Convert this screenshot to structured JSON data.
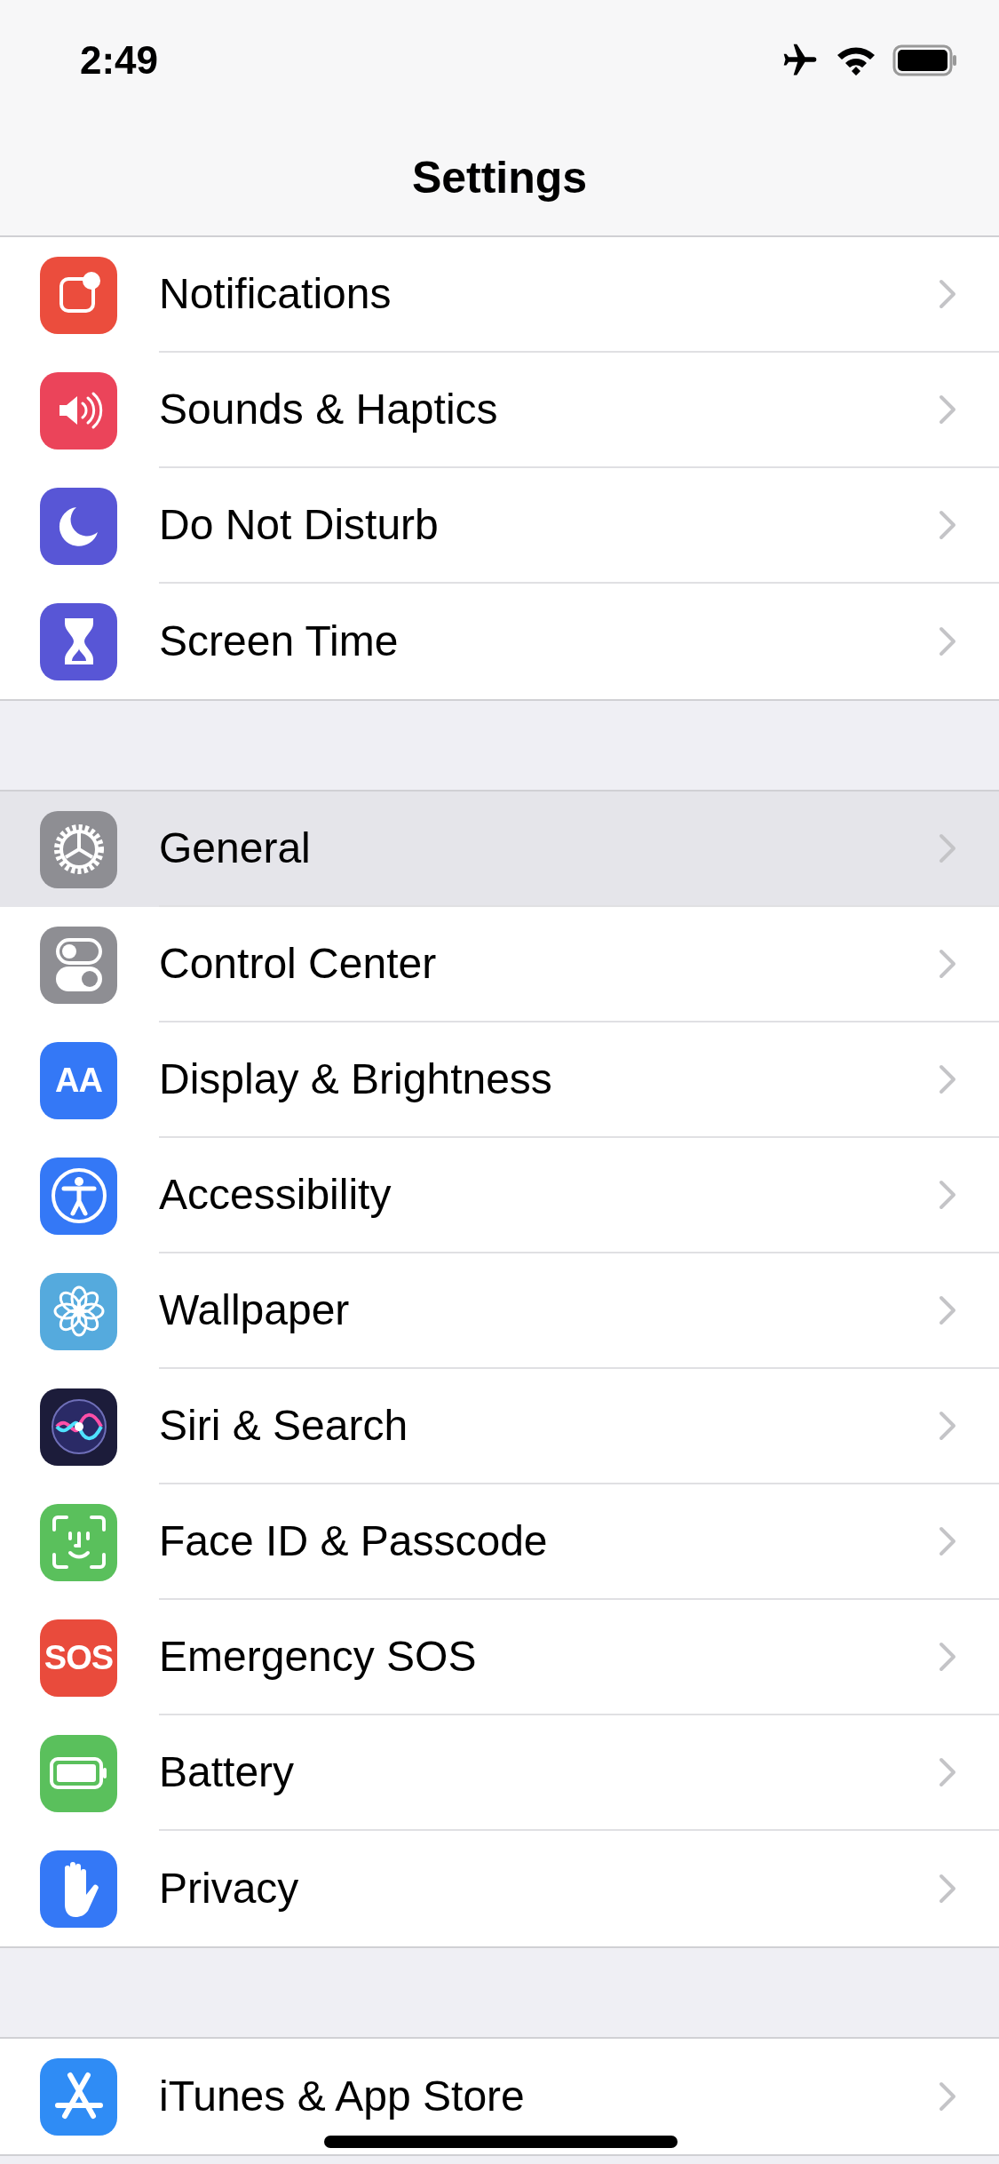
{
  "status_bar": {
    "time": "2:49"
  },
  "nav": {
    "title": "Settings"
  },
  "groups": [
    {
      "items": [
        {
          "label": "Notifications",
          "kind": "notifications",
          "color": "#eb4d3d",
          "selected": false
        },
        {
          "label": "Sounds & Haptics",
          "kind": "sound",
          "color": "#eb445a",
          "selected": false
        },
        {
          "label": "Do Not Disturb",
          "kind": "moon",
          "color": "#5856d6",
          "selected": false
        },
        {
          "label": "Screen Time",
          "kind": "hourglass",
          "color": "#5856d6",
          "selected": false
        }
      ]
    },
    {
      "items": [
        {
          "label": "General",
          "kind": "gear",
          "color": "#8e8e93",
          "selected": true
        },
        {
          "label": "Control Center",
          "kind": "toggles",
          "color": "#8e8e93",
          "selected": false
        },
        {
          "label": "Display & Brightness",
          "kind": "text",
          "icon_text": "AA",
          "color": "#3478f6",
          "selected": false
        },
        {
          "label": "Accessibility",
          "kind": "accessibility",
          "color": "#3478f6",
          "selected": false
        },
        {
          "label": "Wallpaper",
          "kind": "flower",
          "color": "#55aadd",
          "selected": false
        },
        {
          "label": "Siri & Search",
          "kind": "siri",
          "color": "#1c1c3a",
          "selected": false
        },
        {
          "label": "Face ID & Passcode",
          "kind": "face",
          "color": "#5ac05c",
          "selected": false
        },
        {
          "label": "Emergency SOS",
          "kind": "text",
          "icon_text": "SOS",
          "color": "#e94b3c",
          "selected": false
        },
        {
          "label": "Battery",
          "kind": "battery",
          "color": "#5ac05c",
          "selected": false
        },
        {
          "label": "Privacy",
          "kind": "hand",
          "color": "#3478f6",
          "selected": false
        }
      ]
    },
    {
      "items": [
        {
          "label": "iTunes & App Store",
          "kind": "appstore",
          "color": "#2f8cf5",
          "selected": false
        }
      ]
    }
  ]
}
